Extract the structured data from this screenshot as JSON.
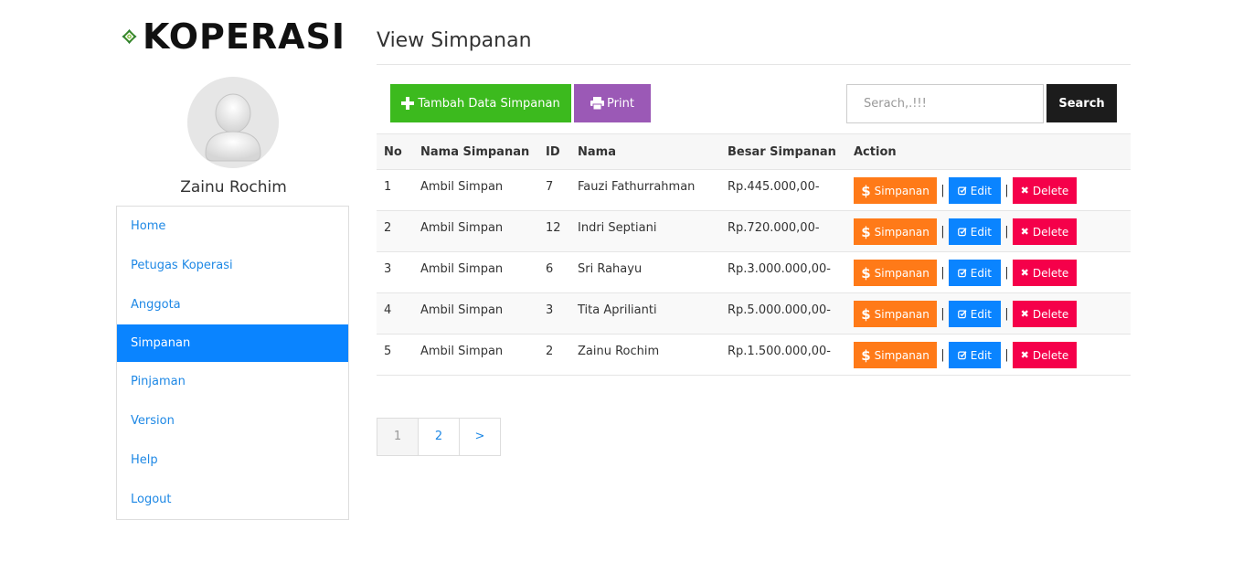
{
  "brand": {
    "logo_text": "KOPERASI"
  },
  "user": {
    "name": "Zainu Rochim"
  },
  "sidebar": {
    "items": [
      {
        "label": "Home",
        "active": false
      },
      {
        "label": "Petugas Koperasi",
        "active": false
      },
      {
        "label": "Anggota",
        "active": false
      },
      {
        "label": "Simpanan",
        "active": true
      },
      {
        "label": "Pinjaman",
        "active": false
      },
      {
        "label": "Version",
        "active": false
      },
      {
        "label": "Help",
        "active": false
      },
      {
        "label": "Logout",
        "active": false
      }
    ]
  },
  "main": {
    "title": "View Simpanan",
    "toolbar": {
      "add_label": "Tambah Data Simpanan",
      "print_label": "Print",
      "search_placeholder": "Serach,.!!!",
      "search_label": "Search"
    },
    "table": {
      "headers": [
        "No",
        "Nama Simpanan",
        "ID",
        "Nama",
        "Besar Simpanan",
        "Action"
      ],
      "rows": [
        {
          "no": "1",
          "nama_simpanan": "Ambil Simpan",
          "id": "7",
          "nama": "Fauzi Fathurrahman",
          "besar": "Rp.445.000,00-"
        },
        {
          "no": "2",
          "nama_simpanan": "Ambil Simpan",
          "id": "12",
          "nama": "Indri Septiani",
          "besar": "Rp.720.000,00-"
        },
        {
          "no": "3",
          "nama_simpanan": "Ambil Simpan",
          "id": "6",
          "nama": "Sri Rahayu",
          "besar": "Rp.3.000.000,00-"
        },
        {
          "no": "4",
          "nama_simpanan": "Ambil Simpan",
          "id": "3",
          "nama": "Tita Aprilianti",
          "besar": "Rp.5.000.000,00-"
        },
        {
          "no": "5",
          "nama_simpanan": "Ambil Simpan",
          "id": "2",
          "nama": "Zainu Rochim",
          "besar": "Rp.1.500.000,00-"
        }
      ],
      "actions": {
        "simpanan": "Simpanan",
        "edit": "Edit",
        "delete": "Delete",
        "separator": "|"
      }
    },
    "pagination": {
      "pages": [
        "1",
        "2",
        ">"
      ],
      "current": "1"
    }
  },
  "colors": {
    "accent": "#0a84ff",
    "add": "#3cba1e",
    "print": "#9b59b6",
    "search": "#1c1c1c",
    "simpanan": "#ff7a18",
    "edit": "#0a84ff",
    "delete": "#f5004a"
  },
  "icons": {
    "add": "plus-icon",
    "print": "printer-icon",
    "simpanan": "dollar-icon",
    "edit": "edit-icon",
    "delete": "times-icon",
    "logo": "koperasi-emblem-icon",
    "avatar": "user-avatar-icon"
  }
}
